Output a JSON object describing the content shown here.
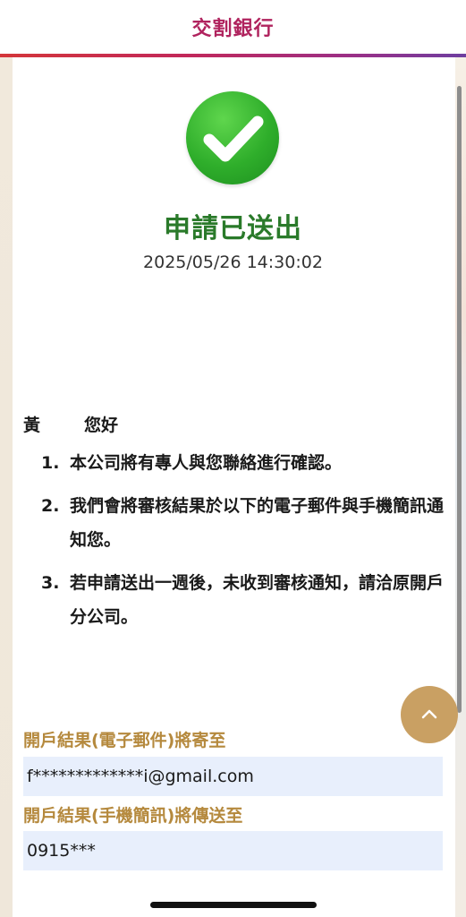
{
  "header": {
    "title": "交割銀行"
  },
  "status": {
    "icon": "checkmark-success-icon",
    "title": "申請已送出",
    "timestamp": "2025/05/26 14:30:02"
  },
  "greeting": {
    "surname": "黃",
    "hello": "您好"
  },
  "notices": [
    {
      "number": "1.",
      "text": "本公司將有專人與您聯絡進行確認。"
    },
    {
      "number": "2.",
      "text": "我們會將審核結果於以下的電子郵件與手機簡訊通知您。"
    },
    {
      "number": "3.",
      "text": "若申請送出一週後，未收到審核通知，請洽原開戶分公司。"
    }
  ],
  "email_section": {
    "label": "開戶結果(電子郵件)將寄至",
    "value": "f*************i@gmail.com"
  },
  "sms_section": {
    "label": "開戶結果(手機簡訊)將傳送至",
    "value": "0915***"
  },
  "scroll_top": {
    "icon": "chevron-up-icon"
  },
  "colors": {
    "brand": "#b0235e",
    "success": "#2a7a2a",
    "section_label": "#b5893d",
    "scroll_button": "#c9a063",
    "value_box": "#e8effc"
  }
}
